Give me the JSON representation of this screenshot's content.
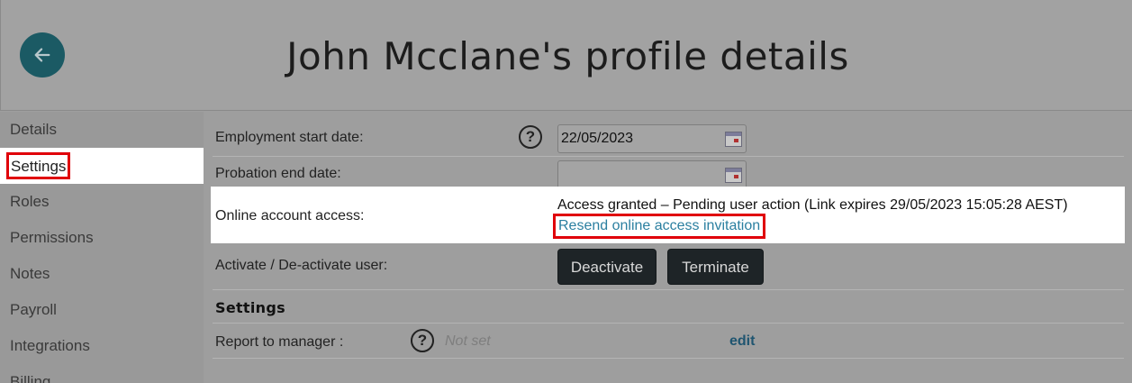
{
  "header": {
    "title": "John Mcclane's profile details",
    "back_icon": "arrow-left-icon"
  },
  "sidebar": {
    "items": [
      {
        "label": "Details",
        "active": false
      },
      {
        "label": "Settings",
        "active": true
      },
      {
        "label": "Roles",
        "active": false
      },
      {
        "label": "Permissions",
        "active": false
      },
      {
        "label": "Notes",
        "active": false
      },
      {
        "label": "Payroll",
        "active": false
      },
      {
        "label": "Integrations",
        "active": false
      },
      {
        "label": "Billing",
        "active": false
      }
    ]
  },
  "form": {
    "employment_start": {
      "label": "Employment start date:",
      "help": "?",
      "value": "22/05/2023"
    },
    "probation_end": {
      "label": "Probation end date:",
      "value": ""
    },
    "online_access": {
      "label": "Online account access:",
      "status": "Access granted – Pending user action (Link expires 29/05/2023 15:05:28 AEST)",
      "resend_link": "Resend online access invitation"
    },
    "activate": {
      "label": "Activate / De-activate user:",
      "deactivate_button": "Deactivate",
      "terminate_button": "Terminate"
    }
  },
  "settings": {
    "title": "Settings",
    "report_to_manager": {
      "label": "Report to manager :",
      "help": "?",
      "value": "Not set",
      "edit": "edit"
    }
  },
  "colors": {
    "back_button": "#1b5a64",
    "highlight_border": "#e0000a",
    "link": "#2b7fa0",
    "button_bg": "#1e2427"
  }
}
